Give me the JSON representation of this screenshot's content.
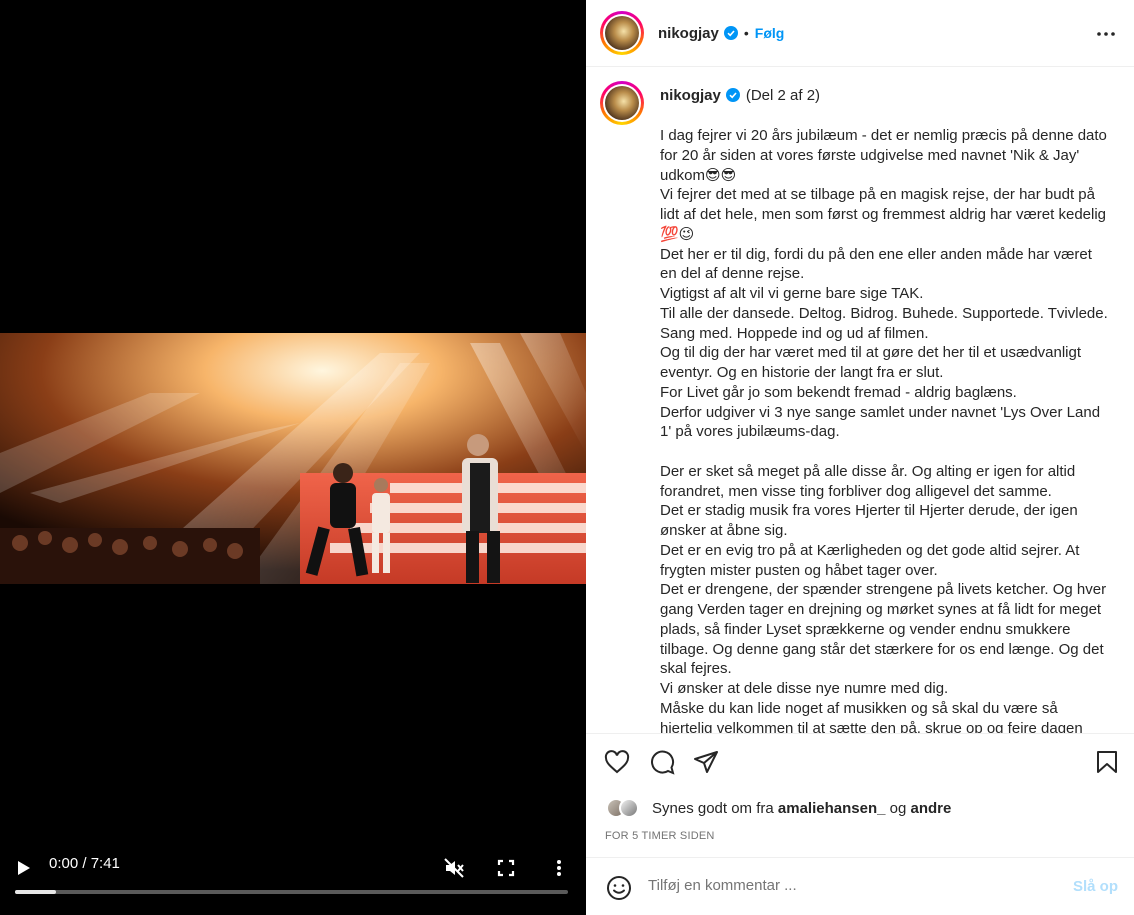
{
  "video": {
    "time": "0:00 / 7:41",
    "progress_fraction": 0.075,
    "icons": {
      "play": "play-icon",
      "mute": "volume-muted-icon",
      "fullscreen": "fullscreen-icon",
      "more": "more-vertical-icon"
    }
  },
  "header": {
    "username": "nikogjay",
    "dot": "•",
    "follow_label": "Følg",
    "more_icon": "more-horizontal-icon"
  },
  "caption": {
    "username": "nikogjay",
    "part": "(Del 2 af 2)",
    "text": "I dag fejrer vi 20 års jubilæum - det er nemlig præcis på denne dato for 20 år siden at vores første udgivelse med navnet 'Nik & Jay' udkom😎😎\nVi fejrer det med at se tilbage på en magisk rejse, der har budt på lidt af det hele, men som først og fremmest aldrig har været kedelig 💯😉\nDet her er til dig, fordi du på den ene eller anden måde har været en del af denne rejse.\nVigtigst af alt vil vi gerne bare sige TAK.\nTil alle der dansede. Deltog. Bidrog. Buhede. Supportede. Tvivlede. Sang med. Hoppede ind og ud af filmen.\nOg til dig der har været med til at gøre det her til et usædvanligt eventyr. Og en historie der langt fra er slut.\nFor Livet går jo som bekendt fremad - aldrig baglæns.\nDerfor udgiver vi 3 nye sange samlet under navnet 'Lys Over Land 1' på vores jubilæums-dag.\n\nDer er sket så meget på alle disse år. Og alting er igen for altid forandret, men visse ting forbliver dog alligevel det samme.\nDet er stadig musik fra vores Hjerter til Hjerter derude, der igen ønsker at åbne sig.\nDet er en evig tro på at Kærligheden og det gode altid sejrer. At frygten mister pusten og håbet tager over.\nDet er drengene, der spænder strengene på livets ketcher. Og hver gang Verden tager en drejning og mørket synes at få lidt for meget plads, så finder Lyset sprækkerne og vender endnu smukkere tilbage. Og denne gang står det stærkere for os end længe. Og det skal fejres.\nVi ønsker at dele disse nye numre med dig.\nMåske du kan lide noget af musikken og så skal du være så hjertelig velkommen til at sætte den på, skrue op og fejre dagen"
  },
  "actions": {
    "icons": [
      "heart-icon",
      "comment-icon",
      "share-icon",
      "bookmark-icon"
    ],
    "likes_prefix": "Synes godt om fra",
    "likes_user": "amaliehansen_",
    "likes_and": "og",
    "likes_others": "andre",
    "time_ago": "FOR 5 TIMER SIDEN"
  },
  "comment": {
    "placeholder": "Tilføj en kommentar ...",
    "post_label": "Slå op",
    "emoji_icon": "emoji-icon"
  }
}
